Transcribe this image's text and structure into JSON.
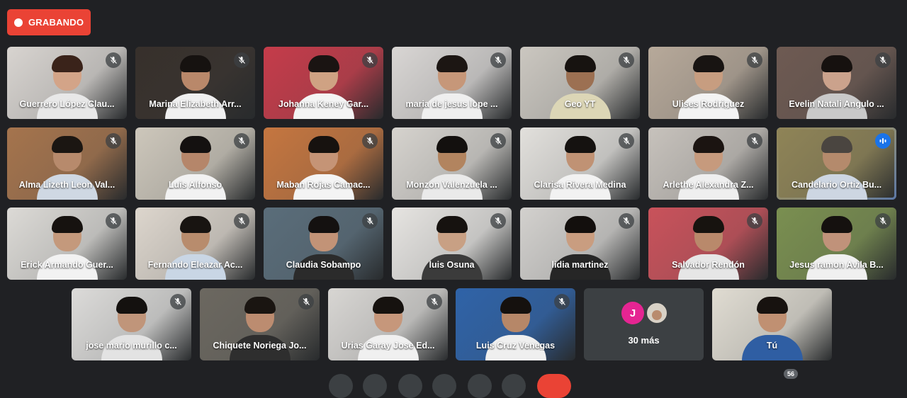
{
  "recording": {
    "label": "GRABANDO"
  },
  "tiles": [
    {
      "name": "Guerrero López Clau...",
      "bg": "#d8d4d0",
      "shirt": "#e8e8e8",
      "hair": "#3a231a",
      "skin": "#d3a488",
      "muted": true
    },
    {
      "name": "Marina Elizabeth Arr...",
      "bg": "#37302b",
      "shirt": "#f0f0f0",
      "hair": "#161210",
      "skin": "#b9886a",
      "muted": true
    },
    {
      "name": "Johanna Keney Gar...",
      "bg": "#c53c4a",
      "shirt": "#f4f4f4",
      "hair": "#1a1412",
      "skin": "#cfa283",
      "muted": true
    },
    {
      "name": "maria de jesus lope ...",
      "bg": "#d9d6d4",
      "shirt": "#efefef",
      "hair": "#1c1613",
      "skin": "#c69779",
      "muted": true
    },
    {
      "name": "Geo YT",
      "bg": "#cbc7c0",
      "shirt": "#dcd6b6",
      "hair": "#171310",
      "skin": "#9c7052",
      "muted": true
    },
    {
      "name": "Ulises Rodriguez",
      "bg": "#b7a99a",
      "shirt": "#f3f3f3",
      "hair": "#181412",
      "skin": "#c79d80",
      "muted": true
    },
    {
      "name": "Evelin Natali Angulo ...",
      "bg": "#6e5a52",
      "shirt": "#c9c9c9",
      "hair": "#16110f",
      "skin": "#cba28c",
      "muted": true
    },
    {
      "name": "Alma Lizeth Leon Val...",
      "bg": "#a5744d",
      "shirt": "#cfd8e3",
      "hair": "#1b1612",
      "skin": "#b78a6c",
      "muted": true
    },
    {
      "name": "Luis Alfonso",
      "bg": "#cdc7bb",
      "shirt": "#f2f2f2",
      "hair": "#141110",
      "skin": "#b5866a",
      "muted": true
    },
    {
      "name": "Maban Rojas Camac...",
      "bg": "#c57640",
      "shirt": "#f4f4f4",
      "hair": "#17120f",
      "skin": "#c59476",
      "muted": true
    },
    {
      "name": "Monzon Valenzuela ...",
      "bg": "#d6d3ce",
      "shirt": "#eaeaea",
      "hair": "#13100e",
      "skin": "#b2845f",
      "muted": true
    },
    {
      "name": "Clarisa Rivera Medina",
      "bg": "#e2e0dc",
      "shirt": "#f2f2f2",
      "hair": "#151210",
      "skin": "#c09274",
      "muted": true
    },
    {
      "name": "Arlethe Alexandra Z...",
      "bg": "#c7c2bc",
      "shirt": "#efefef",
      "hair": "#1b1411",
      "skin": "#c69a7d",
      "muted": true
    },
    {
      "name": "Candelario Ortiz Bu...",
      "bg": "#8f8457",
      "shirt": "#cdd6e2",
      "hair": "#4a4540",
      "skin": "#b48a6c",
      "muted": false,
      "active": true
    },
    {
      "name": "Erick Armando Guer...",
      "bg": "#dcdad6",
      "shirt": "#f2f2f2",
      "hair": "#16120f",
      "skin": "#c4997c",
      "muted": true
    },
    {
      "name": "Fernando Eleazar Ac...",
      "bg": "#ddd6cd",
      "shirt": "#c9d6e5",
      "hair": "#181411",
      "skin": "#b88c6d",
      "muted": true
    },
    {
      "name": "Claudia Sobampo",
      "bg": "#5a6d7a",
      "shirt": "#2b2b2b",
      "hair": "#141110",
      "skin": "#c29377",
      "muted": true
    },
    {
      "name": "luis Osuna",
      "bg": "#e6e4e1",
      "shirt": "#3b3b3b",
      "hair": "#16120f",
      "skin": "#c8a084",
      "muted": true
    },
    {
      "name": "lidia martinez",
      "bg": "#d3d1ce",
      "shirt": "#262626",
      "hair": "#130f0d",
      "skin": "#c99d80",
      "muted": true
    },
    {
      "name": "Salvador Rendón",
      "bg": "#c9525b",
      "shirt": "#e6e6e6",
      "hair": "#17130f",
      "skin": "#b9896b",
      "muted": true
    },
    {
      "name": "Jesus ramon Avila B...",
      "bg": "#7a8f50",
      "shirt": "#f0f0f0",
      "hair": "#15110f",
      "skin": "#c0927a",
      "muted": true
    },
    {
      "name": "jose mario murillo c...",
      "bg": "#dcdbd9",
      "shirt": "#e3e3e3",
      "hair": "#14110f",
      "skin": "#c0957a",
      "muted": true
    },
    {
      "name": "Chiquete Noriega Jo...",
      "bg": "#6c6860",
      "shirt": "#2e2e2e",
      "hair": "#1a1511",
      "skin": "#bc8c70",
      "muted": true
    },
    {
      "name": "Urias Garay Jose Ed...",
      "bg": "#d8d6d3",
      "shirt": "#f0f0f0",
      "hair": "#16120f",
      "skin": "#c6977b",
      "muted": true
    },
    {
      "name": "Luis Cruz Venegas",
      "bg": "#2f63a8",
      "shirt": "#efefef",
      "hair": "#15110e",
      "skin": "#b68768",
      "muted": true
    },
    {
      "name": "Tú",
      "bg": "#e0dcd2",
      "shirt": "#2f5ea3",
      "hair": "#17120f",
      "skin": "#c09072",
      "muted": false,
      "self": true
    }
  ],
  "more_participants": {
    "label": "30 más",
    "avatar_letter": "J",
    "avatar_color": "#e52592"
  },
  "participant_count": "56"
}
